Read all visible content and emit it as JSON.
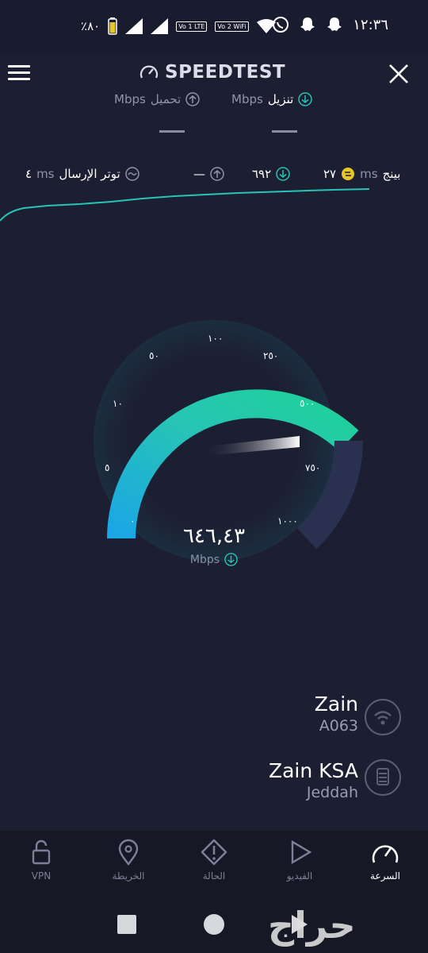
{
  "status_bar": {
    "battery_text": "٪٨٠",
    "sim1_text": "Vo 1 LTE",
    "sim2_text": "Vo 2 WiFi",
    "time": "١٢:٣٦"
  },
  "header": {
    "title": "SPEEDTEST"
  },
  "metrics": {
    "download_label": "تنزيل",
    "download_unit": "Mbps",
    "upload_label": "تحميل",
    "upload_unit": "Mbps"
  },
  "stats": {
    "ping_label": "بينج",
    "ping_unit": "ms",
    "ping_value": "٢٧",
    "download_value": "٦٩٢",
    "upload_value": "—",
    "jitter_label": "توتر الإرسال",
    "jitter_unit": "ms",
    "jitter_value": "٤"
  },
  "gauge": {
    "ticks": [
      "٠",
      "٥",
      "١٠",
      "٥٠",
      "١٠٠",
      "٢٥٠",
      "٥٠٠",
      "٧٥٠",
      "١٠٠٠"
    ],
    "current_value": "٦٤٦,٤٣",
    "current_value_number": 646.43,
    "unit": "Mbps"
  },
  "connection": {
    "wifi_name": "Zain",
    "wifi_sub": "A063",
    "provider_name": "Zain KSA",
    "provider_sub": "Jeddah"
  },
  "nav": {
    "speed": "السرعة",
    "video": "الفيديو",
    "status": "الحالة",
    "map": "الخريطة",
    "vpn": "VPN"
  },
  "watermark": "حراج",
  "colors": {
    "accent_teal": "#27c4b5",
    "accent_blue": "#1aa6e6",
    "accent_green": "#1fd19a",
    "background": "#1c1f32"
  }
}
